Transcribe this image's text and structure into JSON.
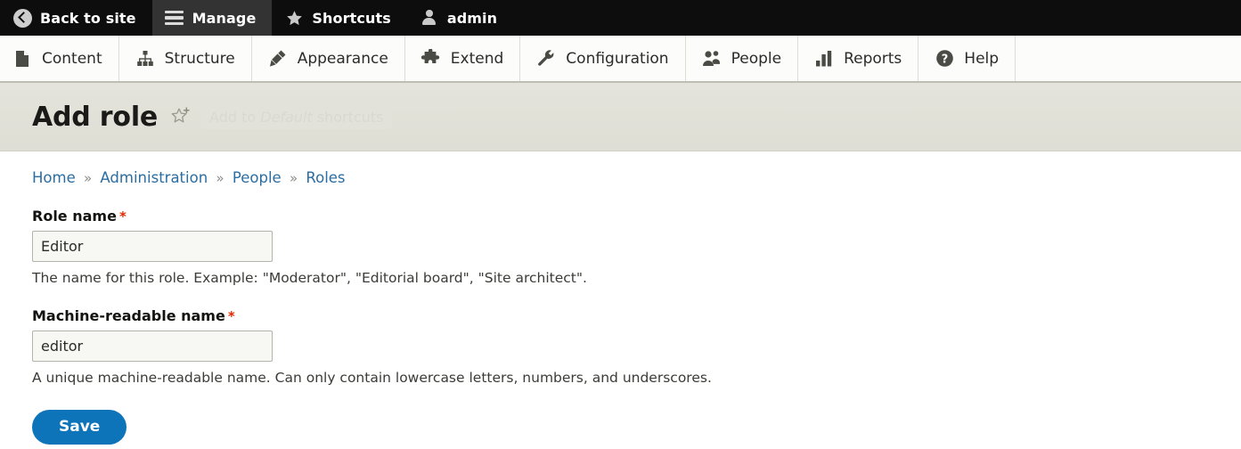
{
  "toolbar": {
    "items": [
      {
        "label": "Back to site",
        "icon": "back-arrow-icon",
        "active": false
      },
      {
        "label": "Manage",
        "icon": "hamburger-icon",
        "active": true
      },
      {
        "label": "Shortcuts",
        "icon": "star-icon",
        "active": false
      },
      {
        "label": "admin",
        "icon": "user-icon",
        "active": false
      }
    ]
  },
  "admin_menu": {
    "items": [
      {
        "label": "Content",
        "icon": "document-icon"
      },
      {
        "label": "Structure",
        "icon": "sitemap-icon"
      },
      {
        "label": "Appearance",
        "icon": "paintbrush-icon"
      },
      {
        "label": "Extend",
        "icon": "puzzle-piece-icon"
      },
      {
        "label": "Configuration",
        "icon": "wrench-icon"
      },
      {
        "label": "People",
        "icon": "people-icon"
      },
      {
        "label": "Reports",
        "icon": "bar-chart-icon"
      },
      {
        "label": "Help",
        "icon": "question-mark-icon"
      }
    ]
  },
  "page": {
    "title": "Add role",
    "shortcut": {
      "icon": "star-plus-icon",
      "tooltip_prefix": "Add to ",
      "tooltip_emphasis": "Default",
      "tooltip_suffix": " shortcuts"
    }
  },
  "breadcrumb": {
    "items": [
      "Home",
      "Administration",
      "People",
      "Roles"
    ],
    "separator": "»"
  },
  "form": {
    "fields": [
      {
        "label": "Role name",
        "required_marker": "*",
        "value": "Editor",
        "placeholder": "",
        "description": "The name for this role. Example: \"Moderator\", \"Editorial board\", \"Site architect\"."
      },
      {
        "label": "Machine-readable name",
        "required_marker": "*",
        "value": "editor",
        "placeholder": "",
        "description": "A unique machine-readable name. Can only contain lowercase letters, numbers, and underscores."
      }
    ],
    "submit_label": "Save"
  },
  "colors": {
    "toolbar_bg": "#0d0d0d",
    "toolbar_active_bg": "#333333",
    "title_band_bg": "#e0e0d8",
    "link": "#2b6ea3",
    "required": "#e32700",
    "primary_button": "#0d74ba"
  }
}
